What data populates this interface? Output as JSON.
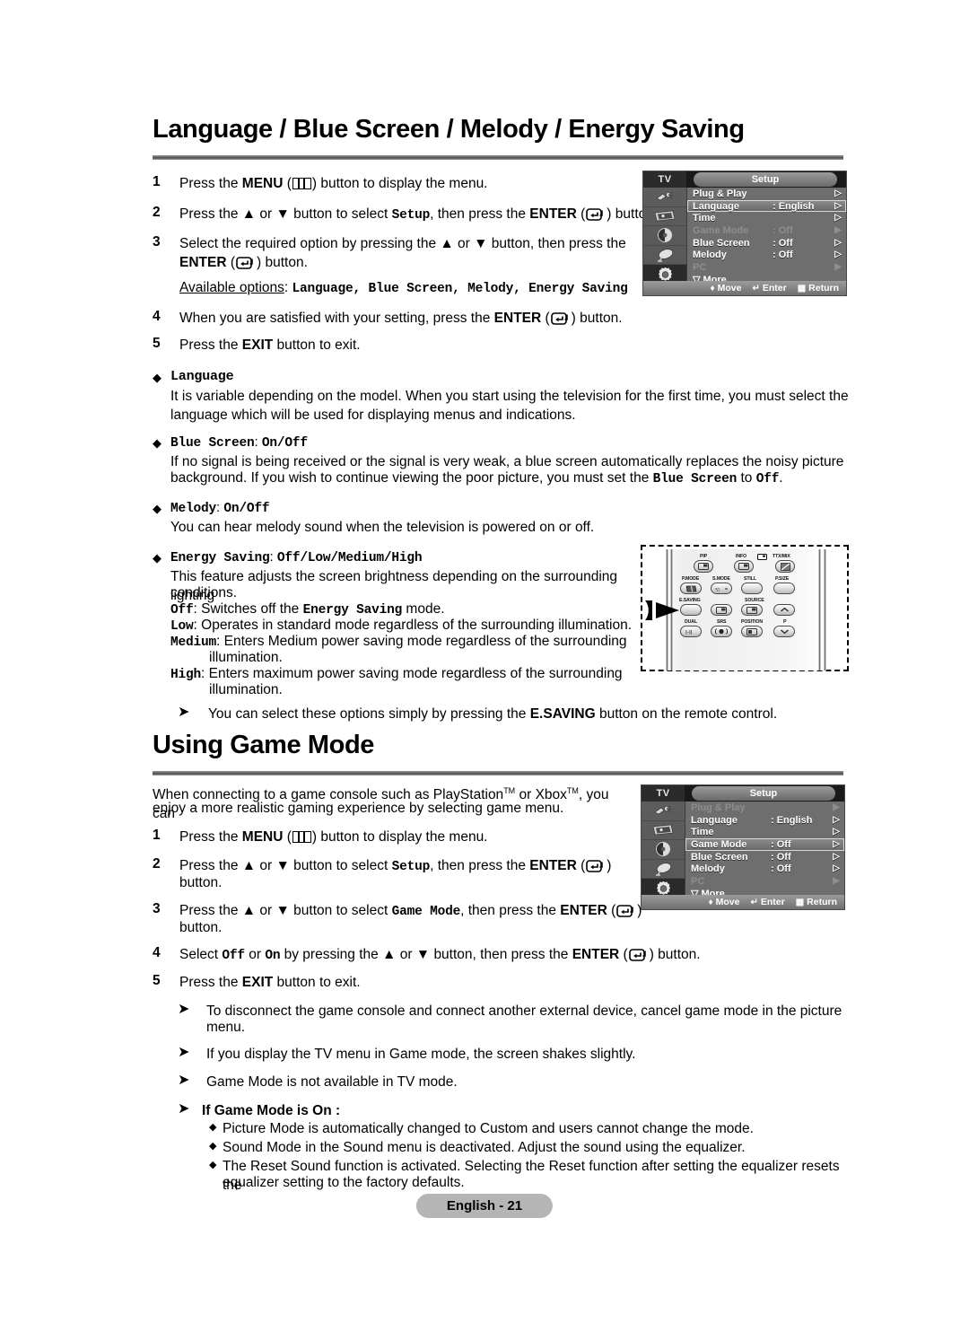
{
  "page": {
    "footer_label": "English - 21"
  },
  "section1": {
    "title": "Language / Blue Screen / Melody / Energy Saving",
    "steps": [
      {
        "num": "1",
        "pre": "Press the ",
        "bold1": "MENU",
        "icon": "menu-icon",
        "post": " button to display the menu."
      },
      {
        "num": "2",
        "text": "Press the ▲ or ▼ button to select Setup, then press the ENTER ( ) button."
      },
      {
        "num": "3",
        "text": "Select the required option by pressing the ▲ or ▼ button, then press the ENTER ( ) button."
      },
      {
        "num": "4",
        "text": "When you are satisfied with your setting, press the ENTER ( ) button."
      },
      {
        "num": "5",
        "text": "Press the EXIT button to exit."
      }
    ],
    "step1_a": "Press the ",
    "step1_menu": "MENU",
    "step1_b": " button to display the menu.",
    "step2_a": "Press the ▲ or ▼ button to select ",
    "step2_setup": "Setup",
    "step2_b": ", then press the ",
    "step2_enter": "ENTER",
    "step2_c": " button.",
    "step3_a": "Select the required option by pressing the ▲ or ▼ button, then press the",
    "step3_enter": "ENTER",
    "step3_b": " button.",
    "avail_label": "Available options",
    "avail_colon": ": ",
    "avail_options": "Language, Blue Screen, Melody, Energy Saving",
    "step4_a": "When you are satisfied with your setting, press the ",
    "step4_enter": "ENTER",
    "step4_b": " button.",
    "step5_a": "Press the ",
    "step5_exit": "EXIT",
    "step5_b": " button to exit.",
    "bullets": [
      {
        "head": "Language",
        "head_mono": "Language",
        "body": "It is variable depending on the model. When you start using the television for the first time, you must select the language which will be used for displaying menus and indications."
      },
      {
        "head_mono": "Blue Screen",
        "head_tail": ": ",
        "head_mono2": "On/Off",
        "body1": "If no signal is being received or the signal is very weak, a blue screen automatically replaces the noisy picture",
        "body2a": "background. If you wish to continue viewing the poor picture, you must set the ",
        "body2mono": "Blue Screen",
        "body2b": " to ",
        "body2mono2": "Off",
        "body2c": "."
      },
      {
        "head_mono": "Melody",
        "head_tail": ": ",
        "head_mono2": "On/Off",
        "body": "You can hear melody sound when the television is powered on or off."
      }
    ],
    "energy": {
      "head_mono": "Energy Saving",
      "head_tail": ": ",
      "head_mono2": "Off/Low/Medium/High",
      "intro1": "This feature adjusts the screen brightness depending on the surrounding lighting",
      "intro2": "conditions.",
      "rows": [
        {
          "key": "Off",
          "text": "Switches off the ",
          "mono": "Energy Saving",
          "tail": " mode."
        },
        {
          "key": "Low",
          "text": "Operates in standard mode regardless of the surrounding illumination."
        },
        {
          "key": "Medium",
          "text": "Enters Medium power saving mode regardless of the surrounding"
        },
        {
          "key": "High",
          "text": "Enters maximum power saving mode regardless of the surrounding"
        }
      ],
      "cont_medium": "illumination.",
      "cont_high": "illumination."
    },
    "note_a": "You can select these options simply by pressing the ",
    "note_b": "E.SAVING",
    "note_c": " button on the remote control."
  },
  "section2": {
    "title": "Using Game Mode",
    "intro1": "When connecting to a game console such as PlayStation",
    "intro_tm1": "TM",
    "intro2": " or Xbox",
    "intro_tm2": "TM",
    "intro3": ", you can",
    "intro4": "enjoy a more realistic gaming experience by selecting game menu.",
    "step1_a": "Press the ",
    "step1_menu": "MENU",
    "step1_b": " button to display the menu.",
    "step2_a": "Press the ▲ or ▼ button to select ",
    "step2_setup": "Setup",
    "step2_b": ", then press the ",
    "step2_enter": "ENTER",
    "step2_c": "button.",
    "step3_a": "Press the ▲ or ▼ button to select ",
    "step3_game": "Game Mode",
    "step3_b": ", then press the ",
    "step3_enter": "ENTER",
    "step3_c": "button.",
    "step4_a": "Select ",
    "step4_off": "Off",
    "step4_or": " or ",
    "step4_on": "On",
    "step4_b": " by pressing the ▲ or ▼ button, then press the ",
    "step4_enter": "ENTER",
    "step4_c": " button.",
    "step5_a": "Press the ",
    "step5_exit": "EXIT",
    "step5_b": " button to exit.",
    "notes": [
      "To disconnect the game console and connect another external device, cancel game mode in the picture",
      "menu.",
      "If you display the TV menu in Game mode, the screen shakes slightly.",
      "Game Mode is not available in TV mode."
    ],
    "note1_l1": "To disconnect the game console and connect another external device, cancel game mode in the picture",
    "note1_l2": "menu.",
    "note2": "If you display the TV menu in Game mode, the screen shakes slightly.",
    "note3": "Game Mode is not available in TV mode.",
    "note4_head": "If Game Mode is On :",
    "sub_bullets": [
      "Picture Mode is automatically changed to Custom and users cannot change the mode.",
      "Sound Mode in the Sound menu is deactivated. Adjust the sound using the equalizer.",
      "The Reset Sound function is activated. Selecting the Reset function after setting the equalizer resets the",
      "equalizer setting to the factory defaults."
    ],
    "sub1": "Picture Mode is automatically changed to Custom and users cannot change the mode.",
    "sub2": "Sound Mode in the Sound menu is deactivated. Adjust the sound using the equalizer.",
    "sub3a": "The Reset Sound function is activated. Selecting the Reset function after setting the equalizer resets the",
    "sub3b": "equalizer setting to the factory defaults."
  },
  "osd1": {
    "tv_label": "TV",
    "tab_label": "Setup",
    "rows": [
      {
        "label": "Plug & Play",
        "value": "",
        "state": "normal",
        "arrow": "▷"
      },
      {
        "label": "Language",
        "value": ": English",
        "state": "highlight",
        "arrow": "▷"
      },
      {
        "label": "Time",
        "value": "",
        "state": "normal",
        "arrow": "▷"
      },
      {
        "label": "Game Mode",
        "value": ": Off",
        "state": "dim",
        "arrow": "▶"
      },
      {
        "label": "Blue Screen",
        "value": ": Off",
        "state": "normal",
        "arrow": "▷"
      },
      {
        "label": "Melody",
        "value": ": Off",
        "state": "normal",
        "arrow": "▷"
      },
      {
        "label": "PC",
        "value": "",
        "state": "dim",
        "arrow": "▶"
      }
    ],
    "more_label": "▽ More",
    "bottom": {
      "move": "Move",
      "enter": "Enter",
      "return": "Return"
    }
  },
  "osd2": {
    "tv_label": "TV",
    "tab_label": "Setup",
    "rows": [
      {
        "label": "Plug & Play",
        "value": "",
        "state": "dim",
        "arrow": "▶"
      },
      {
        "label": "Language",
        "value": ": English",
        "state": "normal",
        "arrow": "▷"
      },
      {
        "label": "Time",
        "value": "",
        "state": "normal",
        "arrow": "▷"
      },
      {
        "label": "Game Mode",
        "value": ": Off",
        "state": "highlight",
        "arrow": "▷"
      },
      {
        "label": "Blue Screen",
        "value": ": Off",
        "state": "normal",
        "arrow": "▷"
      },
      {
        "label": "Melody",
        "value": ": Off",
        "state": "normal",
        "arrow": "▷"
      },
      {
        "label": "PC",
        "value": "",
        "state": "dim",
        "arrow": "▶"
      }
    ],
    "more_label": "▽ More",
    "bottom": {
      "move": "Move",
      "enter": "Enter",
      "return": "Return"
    }
  },
  "remote": {
    "labels": {
      "pip": "PIP",
      "info": "INFO",
      "ttxmix": "TTX/MIX",
      "pmode": "P.MODE",
      "smode": "S.MODE",
      "still": "STILL",
      "psize": "P.SIZE",
      "esaving": "E.SAVING",
      "source": "SOURCE",
      "dual": "DUAL",
      "srs": "SRS",
      "position": "POSITION",
      "p": "P"
    }
  }
}
